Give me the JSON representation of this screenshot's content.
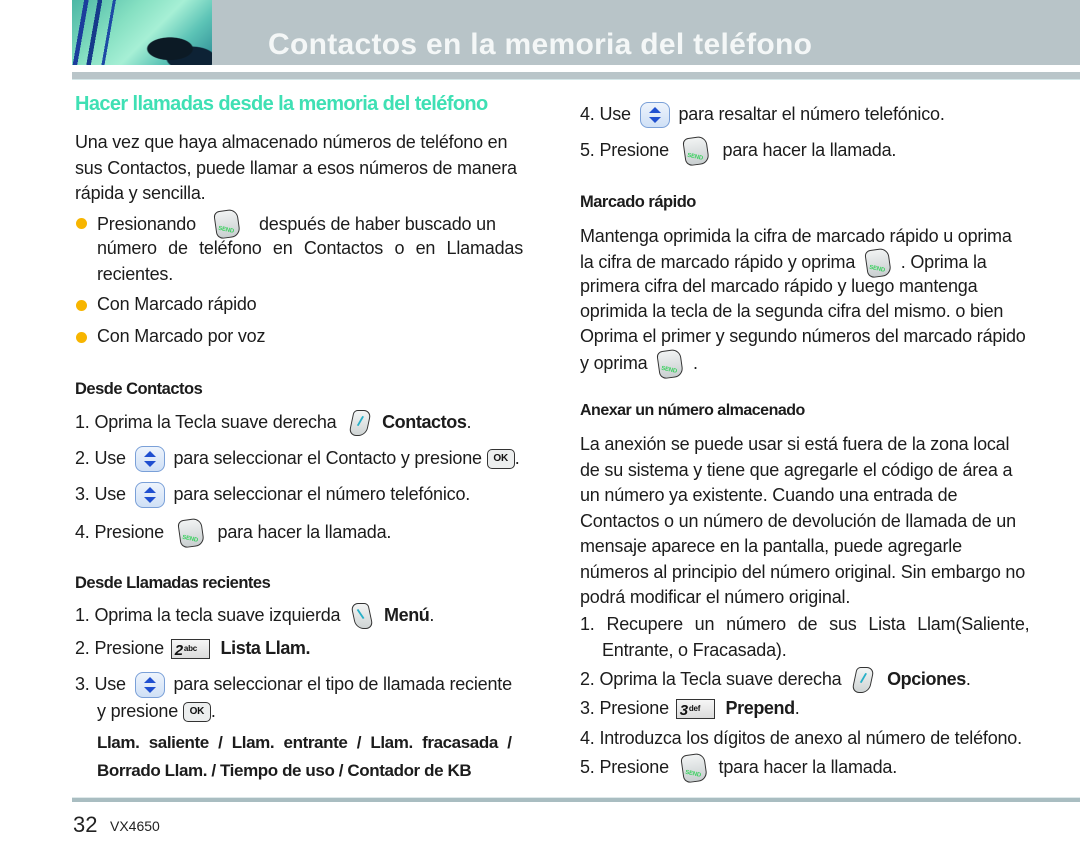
{
  "header": {
    "title": "Contactos en la memoria del teléfono",
    "photo": "header-photo"
  },
  "left": {
    "section_title": "Hacer llamadas desde la memoria del teléfono",
    "intro": "Una vez que haya almacenado números de teléfono en sus Contactos, puede llamar a esos números de manera rápida y sencilla.",
    "bullets": [
      {
        "before": "Presionando",
        "icon": "send-key-icon",
        "after": "después de haber buscado un",
        "cont": "número de teléfono en Contactos o en Llamadas recientes."
      },
      {
        "text": "Con Marcado rápido"
      },
      {
        "text": "Con Marcado por voz"
      }
    ],
    "desde_contactos": {
      "title": "Desde Contactos",
      "steps": [
        {
          "num": "1.",
          "text": "Oprima la Tecla suave derecha",
          "icon": "right-soft-key-icon",
          "bold": "Contactos",
          "end": "."
        },
        {
          "num": "2.",
          "pre": "Use",
          "icon": "navigation-key-icon",
          "text": "para seleccionar el Contacto y presione",
          "icon2": "ok-key-icon",
          "end": "."
        },
        {
          "num": "3.",
          "pre": "Use",
          "icon": "navigation-key-icon",
          "text": "para seleccionar el número telefónico."
        },
        {
          "num": "4.",
          "pre": "Presione",
          "icon": "send-key-icon",
          "text": "para hacer la llamada."
        }
      ]
    },
    "desde_llamadas": {
      "title": "Desde Llamadas recientes",
      "steps": [
        {
          "num": "1.",
          "text": "Oprima la tecla suave izquierda",
          "icon": "left-soft-key-icon",
          "bold": "Menú",
          "end": "."
        },
        {
          "num": "2.",
          "pre": "Presione",
          "key_digit": "2",
          "key_letters": "abc",
          "bold": "Lista Llam."
        },
        {
          "num": "3.",
          "pre": "Use",
          "icon": "navigation-key-icon",
          "text": "para seleccionar el tipo de llamada reciente",
          "cont_pre": "y presione",
          "icon2": "ok-key-icon",
          "end": "."
        }
      ],
      "options_line1": "Llam. saliente / Llam. entrante / Llam. fracasada /",
      "options_line2": "Borrado Llam. / Tiempo de uso / Contador de KB"
    }
  },
  "right": {
    "steps_cont": [
      {
        "num": "4.",
        "pre": "Use",
        "icon": "navigation-key-icon",
        "text": "para resaltar el número telefónico."
      },
      {
        "num": "5.",
        "pre": "Presione",
        "icon": "send-key-icon",
        "text": "para hacer la llamada."
      }
    ],
    "marcado_rapido": {
      "title": "Marcado rápido",
      "line1": "Mantenga oprimida la cifra de marcado rápido u oprima",
      "line2_pre": "la cifra de marcado rápido y oprima",
      "line2_post": ". Oprima la",
      "line3": "primera cifra del marcado rápido y luego mantenga",
      "line4": "oprimida la tecla de la segunda cifra del mismo. o bien",
      "line5": "Oprima el primer y segundo números del marcado rápido",
      "line6_pre": "y oprima",
      "line6_post": "."
    },
    "anexar": {
      "title": "Anexar un número almacenado",
      "body": "La anexión se puede usar si está fuera de la zona local de su sistema y tiene que agregarle el código de área a un número ya existente. Cuando una entrada de Contactos o un número de devolución de llamada de un mensaje aparece en la pantalla, puede agregarle números al principio del número original. Sin embargo no podrá modificar el número original.",
      "steps": [
        {
          "num": "1.",
          "text": "Recupere un número de sus Lista Llam(Saliente,",
          "cont": "Entrante, o Fracasada)."
        },
        {
          "num": "2.",
          "text": "Oprima la Tecla suave derecha",
          "icon": "right-soft-key-icon",
          "bold": "Opciones",
          "end": "."
        },
        {
          "num": "3.",
          "pre": "Presione",
          "key_digit": "3",
          "key_letters": "def",
          "bold": "Prepend",
          "end": "."
        },
        {
          "num": "4.",
          "text": "Introduzca los dígitos de anexo al número de teléfono."
        },
        {
          "num": "5.",
          "pre": "Presione",
          "icon": "send-key-icon",
          "text": "tpara hacer la llamada."
        }
      ]
    }
  },
  "footer": {
    "page_number": "32",
    "model": "VX4650"
  },
  "colors": {
    "section_title": "#3fe0b4",
    "bullet": "#f7b500",
    "header_bar": "#b8c4c8",
    "footer_rule": "#a9bdc1"
  }
}
